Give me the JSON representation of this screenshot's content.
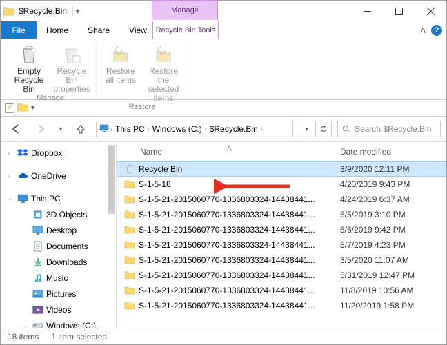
{
  "window": {
    "title": "$Recycle.Bin",
    "contextual_header": "Manage"
  },
  "ribbon_tabs": {
    "file": "File",
    "home": "Home",
    "share": "Share",
    "view": "View",
    "contextual": "Recycle Bin Tools"
  },
  "ribbon": {
    "groups": [
      {
        "label": "Manage",
        "buttons": [
          {
            "key": "empty",
            "line1": "Empty",
            "line2": "Recycle Bin",
            "enabled": true
          },
          {
            "key": "props",
            "line1": "Recycle Bin",
            "line2": "properties",
            "enabled": false
          }
        ]
      },
      {
        "label": "Restore",
        "buttons": [
          {
            "key": "restoreall",
            "line1": "Restore",
            "line2": "all items",
            "enabled": false
          },
          {
            "key": "restoresel",
            "line1": "Restore the",
            "line2": "selected items",
            "enabled": false
          }
        ]
      }
    ]
  },
  "addressbar": {
    "segments": [
      "This PC",
      "Windows (C:)",
      "$Recycle.Bin"
    ]
  },
  "search": {
    "placeholder": "Search $Recycle.Bin"
  },
  "sidebar": [
    {
      "kind": "top",
      "label": "Dropbox",
      "icon": "dropbox"
    },
    {
      "kind": "spacer"
    },
    {
      "kind": "top",
      "label": "OneDrive",
      "icon": "onedrive"
    },
    {
      "kind": "spacer"
    },
    {
      "kind": "top",
      "label": "This PC",
      "icon": "pc",
      "expanded": true
    },
    {
      "kind": "child",
      "label": "3D Objects",
      "icon": "folder3d"
    },
    {
      "kind": "child",
      "label": "Desktop",
      "icon": "desktop"
    },
    {
      "kind": "child",
      "label": "Documents",
      "icon": "docs"
    },
    {
      "kind": "child",
      "label": "Downloads",
      "icon": "downloads"
    },
    {
      "kind": "child",
      "label": "Music",
      "icon": "music"
    },
    {
      "kind": "child",
      "label": "Pictures",
      "icon": "pictures"
    },
    {
      "kind": "child",
      "label": "Videos",
      "icon": "videos"
    },
    {
      "kind": "child",
      "label": "Windows (C:)",
      "icon": "drive",
      "expanded": true
    }
  ],
  "columns": {
    "name": "Name",
    "date": "Date modified"
  },
  "files": [
    {
      "name": "Recycle Bin",
      "date": "3/9/2020 12:11 PM",
      "icon": "recycle",
      "selected": true,
      "clip": false
    },
    {
      "name": "S-1-5-18",
      "date": "4/23/2019 9:43 PM",
      "icon": "folder",
      "clip": false
    },
    {
      "name": "S-1-5-21-2015060770-1336803324-14438441...",
      "date": "4/24/2019 6:37 AM",
      "icon": "folder",
      "clip": true
    },
    {
      "name": "S-1-5-21-2015060770-1336803324-14438441...",
      "date": "5/5/2019 3:10 PM",
      "icon": "folder",
      "clip": true
    },
    {
      "name": "S-1-5-21-2015060770-1336803324-14438441...",
      "date": "5/6/2019 9:42 PM",
      "icon": "folder",
      "clip": true
    },
    {
      "name": "S-1-5-21-2015060770-1336803324-14438441...",
      "date": "5/7/2019 4:23 PM",
      "icon": "folder",
      "clip": true
    },
    {
      "name": "S-1-5-21-2015060770-1336803324-14438441...",
      "date": "3/5/2020 11:07 AM",
      "icon": "folder",
      "clip": true
    },
    {
      "name": "S-1-5-21-2015060770-1336803324-14438441...",
      "date": "5/31/2019 12:47 PM",
      "icon": "folder",
      "clip": true
    },
    {
      "name": "S-1-5-21-2015060770-1336803324-14438441...",
      "date": "11/8/2019 10:56 AM",
      "icon": "folder",
      "clip": true
    },
    {
      "name": "S-1-5-21-2015060770-1336803324-14438441...",
      "date": "11/20/2019 1:58 PM",
      "icon": "folder",
      "clip": true
    }
  ],
  "status": {
    "items": "18 items",
    "selected": "1 item selected"
  }
}
